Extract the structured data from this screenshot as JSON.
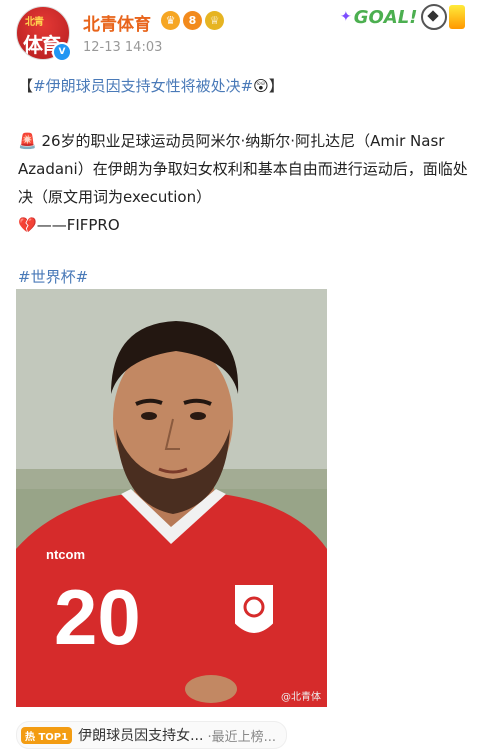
{
  "header": {
    "account_name": "北青体育",
    "avatar_text_top": "北青",
    "avatar_text_main": "体育",
    "timestamp": "12-13 14:03",
    "badge_icons": [
      "crown-badge-icon",
      "level-badge-icon",
      "fan-badge-icon"
    ],
    "goal_sticker_text": "GOAL!"
  },
  "post": {
    "title_open": "【",
    "title_tag": "#伊朗球员因支持女性将被处决#",
    "title_emoji": "😲",
    "title_close": "】",
    "body_alarm_emoji": "🚨",
    "body_text": " 26岁的职业足球运动员阿米尔·纳斯尔·阿扎达尼（Amir Nasr Azadani）在伊朗为争取妇女权利和基本自由而进行运动后，面临处决（原文用词为execution）",
    "body_broken_heart": "💔",
    "body_source": "——FIFPRO",
    "hashtag": "#世界杯#"
  },
  "photo": {
    "jersey_number": "20",
    "sponsor_text": "ntcom",
    "watermark": "@北青体"
  },
  "hot_search": {
    "icon_label": "热 TOP1",
    "text": "伊朗球员因支持女...",
    "sub": "·最近上榜..."
  },
  "colors": {
    "brand_orange": "#e8641b",
    "hashtag_blue": "#4a7ab8",
    "jersey_red": "#d62b2b"
  }
}
